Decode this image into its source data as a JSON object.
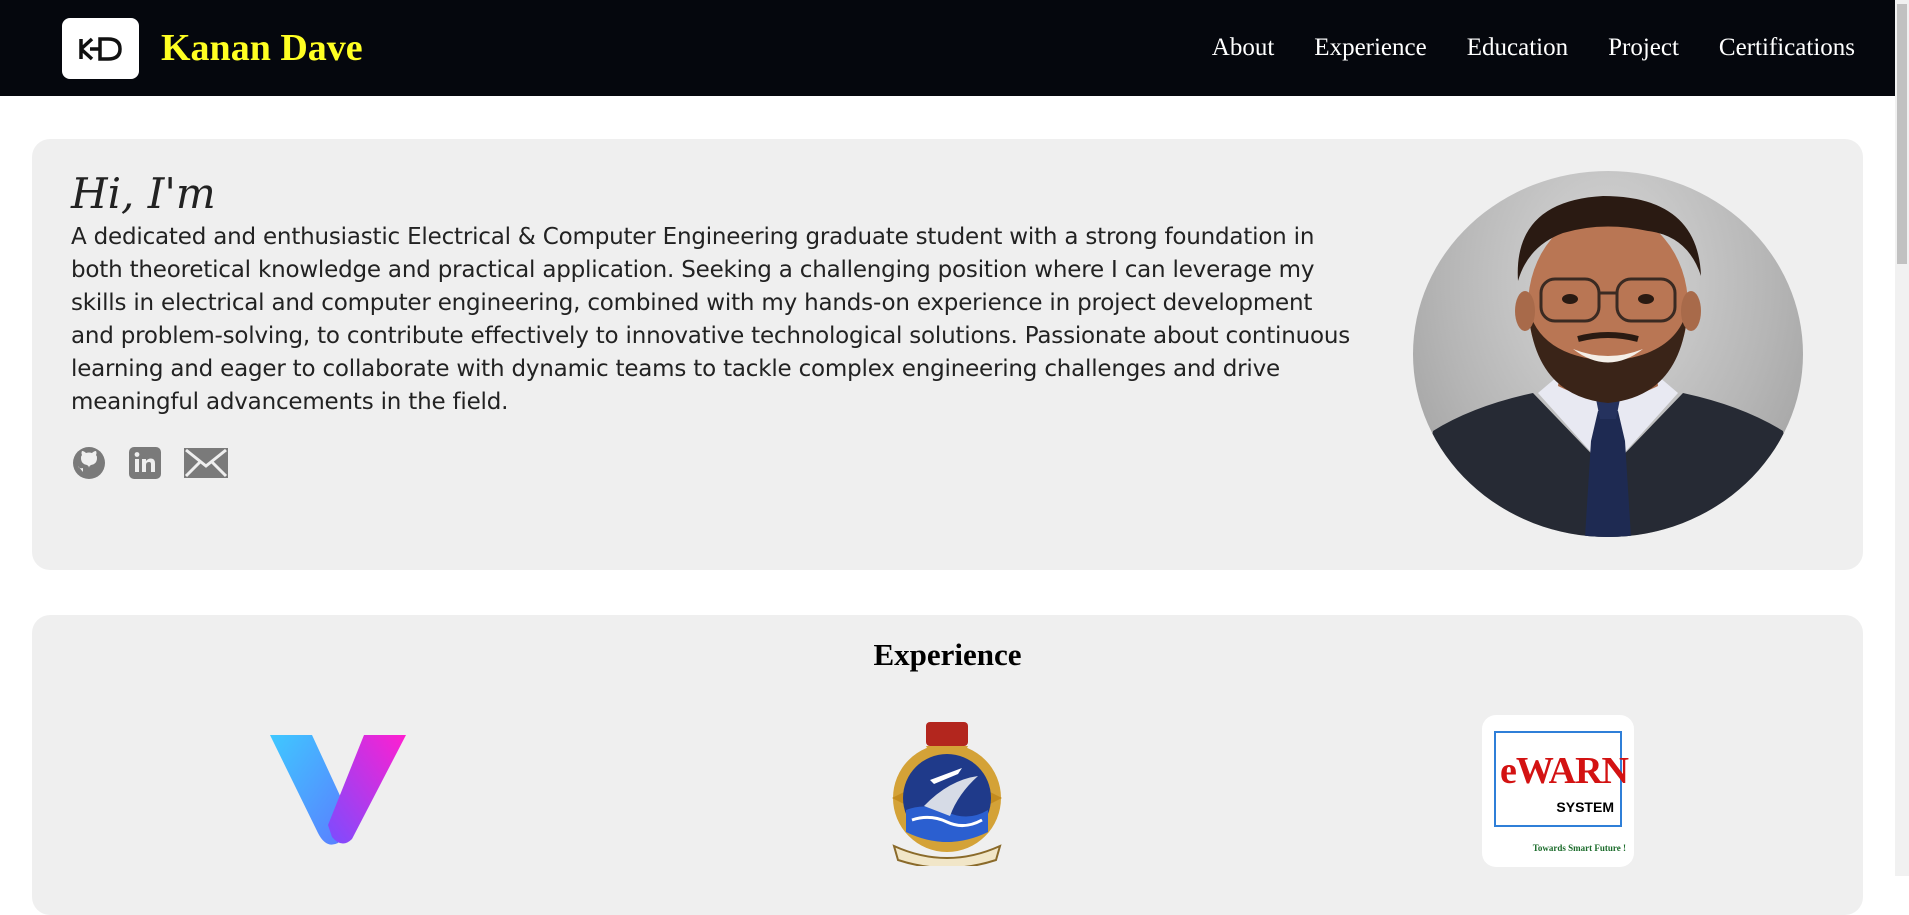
{
  "brand": {
    "logo_text": "KD",
    "name": "Kanan Dave"
  },
  "nav": {
    "items": [
      "About",
      "Experience",
      "Education",
      "Project",
      "Certifications"
    ]
  },
  "hero": {
    "greeting": "Hi, I'm",
    "bio": "A dedicated and enthusiastic Electrical & Computer Engineering graduate student with a strong foundation in both theoretical knowledge and practical application. Seeking a challenging position where I can leverage my skills in electrical and computer engineering, combined with my hands-on experience in project development and problem-solving, to contribute effectively to innovative technological solutions. Passionate about continuous learning and eager to collaborate with dynamic teams to tackle complex engineering challenges and drive meaningful advancements in the field.",
    "socials": [
      "github-icon",
      "linkedin-icon",
      "mail-icon"
    ]
  },
  "experience": {
    "title": "Experience",
    "logos": [
      {
        "icon": "v-logo"
      },
      {
        "icon": "naval-crest-logo"
      },
      {
        "icon": "ewarn-logo",
        "text": "eWARN",
        "sub": "SYSTEM",
        "tagline": "Towards Smart Future !"
      }
    ]
  },
  "colors": {
    "nav_bg": "#05070d",
    "brand_yellow": "#ffff22",
    "card_bg": "#efefef"
  }
}
